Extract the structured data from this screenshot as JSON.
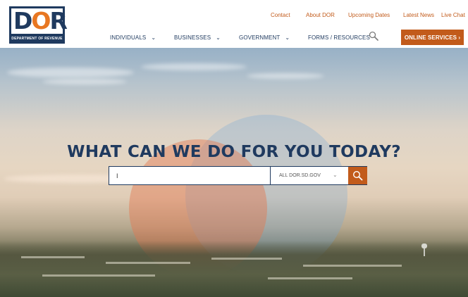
{
  "logo": {
    "letters": [
      "D",
      "O",
      "R"
    ],
    "corner_mark": "SD",
    "subtitle": "DEPARTMENT OF REVENUE"
  },
  "util_nav": {
    "contact": "Contact",
    "about": "About DOR",
    "upcoming": "Upcoming Dates",
    "news": "Latest News",
    "chat": "Live Chat"
  },
  "main_nav": {
    "individuals": "INDIVIDUALS",
    "businesses": "BUSINESSES",
    "government": "GOVERNMENT",
    "forms": "FORMS / RESOURCES",
    "online_services": "ONLINE SERVICES ›"
  },
  "hero": {
    "headline": "WHAT CAN WE DO FOR YOU TODAY?",
    "search_value": "I",
    "scope_selected": "ALL DOR.SD.GOV",
    "scope_chevron": "⌄"
  },
  "colors": {
    "navy": "#1f3a5f",
    "orange": "#c25b1b",
    "logo_orange": "#e87722"
  },
  "icons": [
    "search-icon",
    "chevron-down-icon"
  ]
}
